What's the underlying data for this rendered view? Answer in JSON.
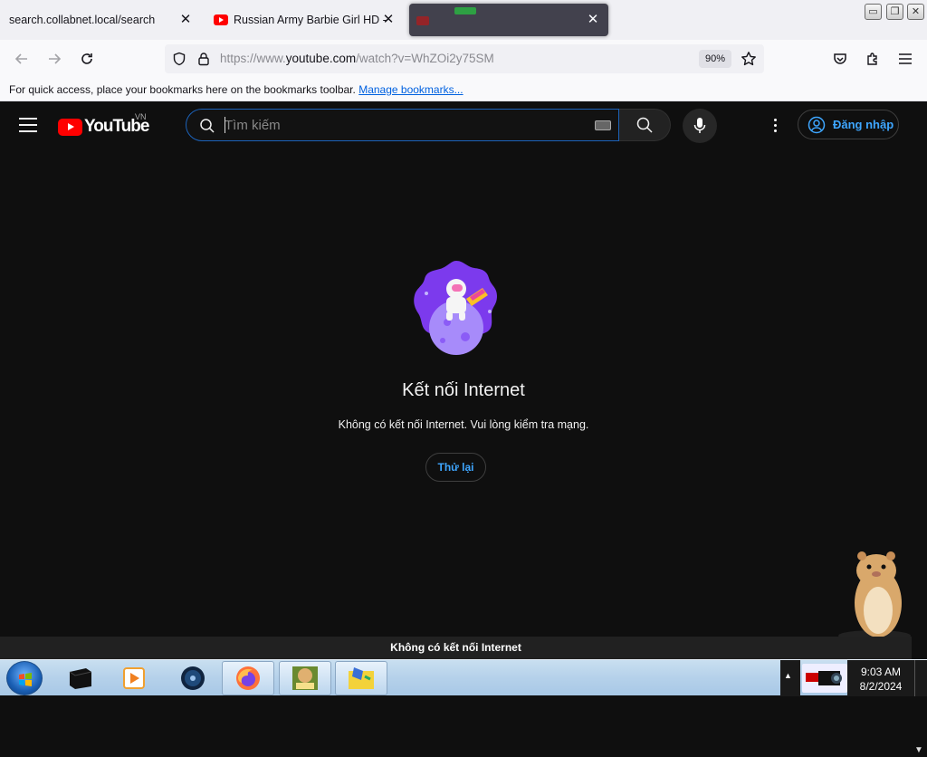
{
  "browser": {
    "tabs": [
      {
        "title": "search.collabnet.local/search",
        "close": "✕"
      },
      {
        "title": "Russian Army Barbie Girl HD -",
        "close": "✕"
      },
      {
        "title": "",
        "close": "✕"
      }
    ],
    "window_buttons": {
      "minimize": "▭",
      "restore": "❐",
      "close": "✕"
    },
    "url": {
      "prefix": "https://www.",
      "host": "youtube.com",
      "path": "/watch?v=WhZOi2y75SM"
    },
    "zoom": "90%",
    "bookmarks_bar": {
      "message": "For quick access, place your bookmarks here on the bookmarks toolbar.",
      "link": "Manage bookmarks..."
    }
  },
  "youtube": {
    "logo_word": "YouTube",
    "country_code": "VN",
    "search_placeholder": "Tìm kiếm",
    "sign_in_label": "Đăng nhập",
    "offline": {
      "title": "Kết nối Internet",
      "message": "Không có kết nối Internet. Vui lòng kiểm tra mạng.",
      "retry_label": "Thử lại"
    },
    "toast": "Không có kết nối Internet",
    "colors": {
      "accent_blue": "#3ea6ff",
      "brand_red": "#ff0000",
      "background": "#0f0f0f"
    }
  },
  "taskbar": {
    "apps": [
      "black-box-app",
      "media-player",
      "disc-globe-app",
      "firefox",
      "sandbox-app",
      "notes-app"
    ],
    "clock_time": "9:03 AM",
    "clock_date": "8/2/2024"
  }
}
